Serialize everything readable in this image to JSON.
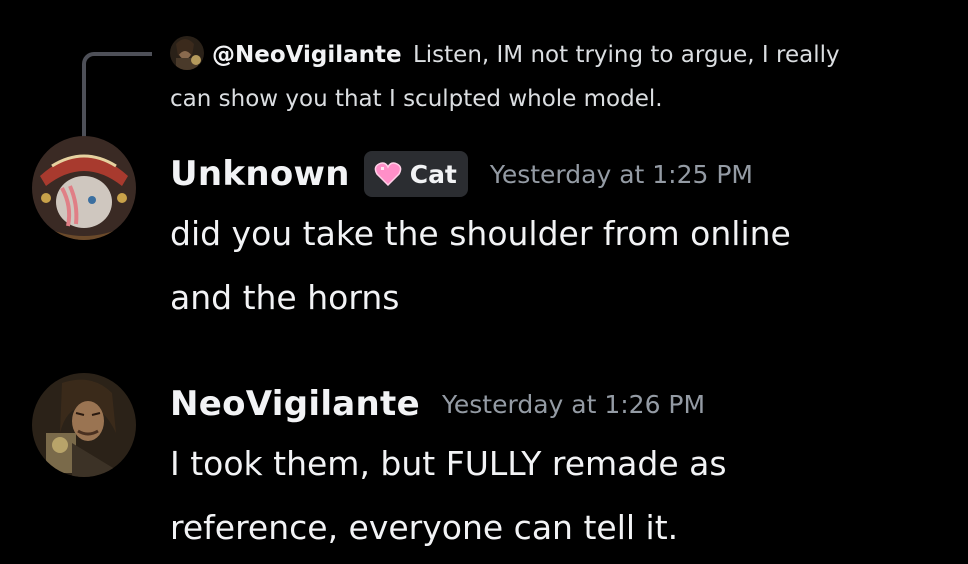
{
  "reply": {
    "mention": "@NeoVigilante",
    "text": "Listen, IM not trying to argue, I really can show you that I sculpted whole model."
  },
  "messages": [
    {
      "username": "Unknown",
      "tag": "Cat",
      "tag_icon": "pink-heart-icon",
      "timestamp": "Yesterday at 1:25 PM",
      "lines": [
        "did you take the shoulder from online",
        "and the horns"
      ]
    },
    {
      "username": "NeoVigilante",
      "timestamp": "Yesterday at 1:26 PM",
      "lines": [
        "I took them, but FULLY remade as",
        "reference, everyone can tell it."
      ]
    }
  ],
  "colors": {
    "background": "#000000",
    "text": "#f2f3f5",
    "muted": "#949ba4",
    "tag_bg": "#2b2d31",
    "heart": "#ff8fc8"
  }
}
